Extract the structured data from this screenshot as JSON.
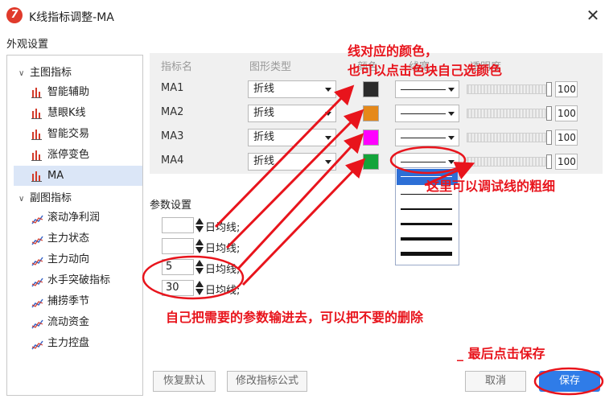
{
  "window": {
    "title": "K线指标调整-MA",
    "app_icon_glyph": "7",
    "close_glyph": "✕"
  },
  "section_title": "外观设置",
  "tree": {
    "main_group": "主图指标",
    "main_items": [
      "智能辅助",
      "慧眼K线",
      "智能交易",
      "涨停变色",
      "MA"
    ],
    "sub_group": "副图指标",
    "sub_items": [
      "滚动净利润",
      "主力状态",
      "主力动向",
      "水手突破指标",
      "捕捞季节",
      "流动资金",
      "主力控盘"
    ],
    "selected": "MA"
  },
  "table": {
    "headers": [
      "指标名",
      "图形类型",
      "颜色",
      "线宽",
      "透明度"
    ],
    "rows": [
      {
        "name": "MA1",
        "type": "折线",
        "color": "#2b2b2b",
        "opacity": "100"
      },
      {
        "name": "MA2",
        "type": "折线",
        "color": "#e5891a",
        "opacity": "100"
      },
      {
        "name": "MA3",
        "type": "折线",
        "color": "#ff00ff",
        "opacity": "100"
      },
      {
        "name": "MA4",
        "type": "折线",
        "color": "#13a43a",
        "opacity": "100"
      }
    ]
  },
  "params": {
    "title": "参数设置",
    "values": [
      "",
      "",
      "5",
      "30"
    ],
    "suffix": "日均线;"
  },
  "buttons": {
    "reset": "恢复默认",
    "edit_formula": "修改指标公式",
    "cancel": "取消",
    "save": "保存"
  },
  "annotations": {
    "color_note_line1": "线对应的颜色，",
    "color_note_line2": "也可以点击色块自己选颜色",
    "width_note": "这里可以调试线的粗细",
    "params_note": "自己把需要的参数输进去，可以把不要的删除",
    "save_note": "_ 最后点击保存"
  },
  "colors": {
    "accent": "#2f7ce8",
    "annotation_red": "#e8141c",
    "selected_row": "#dbe6f7"
  }
}
